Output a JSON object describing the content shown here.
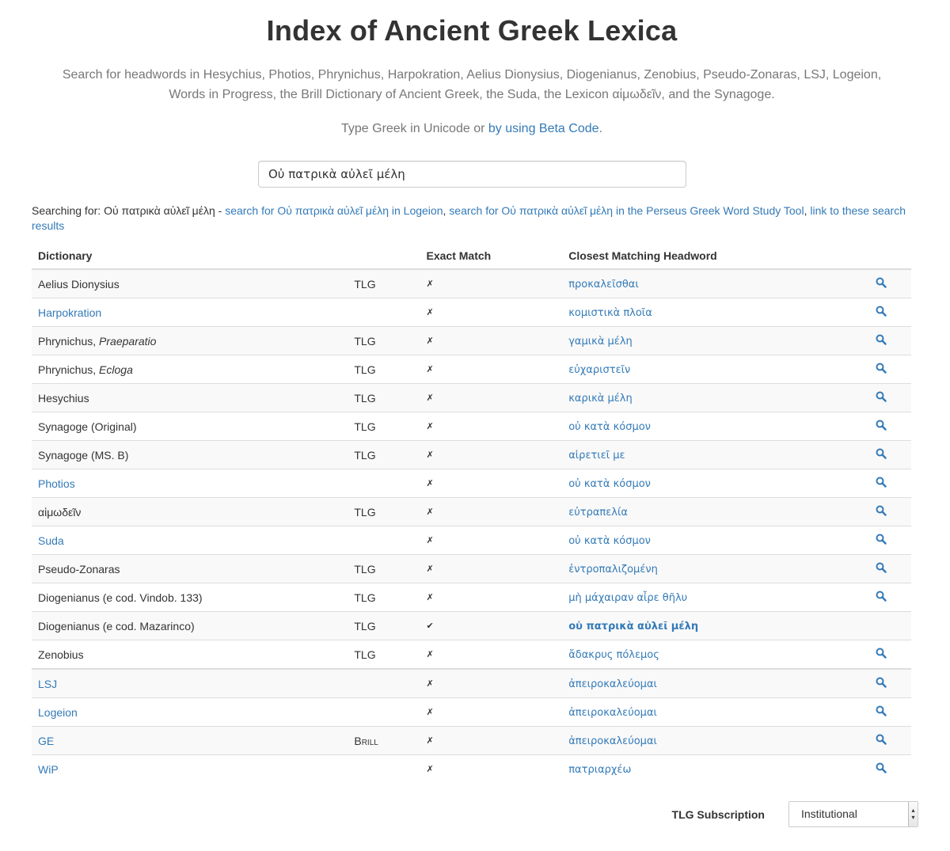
{
  "page": {
    "title": "Index of Ancient Greek Lexica",
    "description": "Search for headwords in Hesychius, Photios, Phrynichus, Harpokration, Aelius Dionysius, Diogenianus, Zenobius, Pseudo-Zonaras, LSJ, Logeion, Words in Progress, the Brill Dictionary of Ancient Greek, the Suda, the Lexicon αἱμωδεῖν, and the Synagoge.",
    "hint_prefix": "Type Greek in Unicode or ",
    "hint_link": "by using Beta Code",
    "hint_suffix": "."
  },
  "search": {
    "value": "Οὐ πατρικὰ αὐλεῖ μέλη",
    "placeholder": ""
  },
  "searching": {
    "prefix": "Searching for: ",
    "term": "Οὐ πατρικὰ αὐλεῖ μέλη",
    "separator": " - ",
    "logeion_link": "search for Οὐ πατρικὰ αὐλεῖ μέλη in Logeion",
    "comma1": ", ",
    "perseus_link": "search for Οὐ πατρικὰ αὐλεῖ μέλη in the Perseus Greek Word Study Tool",
    "comma2": ", ",
    "permalink": "link to these search results"
  },
  "table": {
    "headers": [
      "Dictionary",
      "",
      "Exact Match",
      "Closest Matching Headword",
      ""
    ],
    "rows": [
      {
        "name": "Aelius Dionysius",
        "italic": "",
        "link": false,
        "tlg": "TLG",
        "match": "✗",
        "headword": "προκαλεῖσθαι",
        "exact": false,
        "icon": true
      },
      {
        "name": "Harpokration",
        "italic": "",
        "link": true,
        "tlg": "",
        "match": "✗",
        "headword": "κομιστικὰ πλοῖα",
        "exact": false,
        "icon": true
      },
      {
        "name": "Phrynichus, ",
        "italic": "Praeparatio",
        "link": false,
        "tlg": "TLG",
        "match": "✗",
        "headword": "γαμικὰ μέλη",
        "exact": false,
        "icon": true
      },
      {
        "name": "Phrynichus, ",
        "italic": "Ecloga",
        "link": false,
        "tlg": "TLG",
        "match": "✗",
        "headword": "εὐχαριστεῖν",
        "exact": false,
        "icon": true
      },
      {
        "name": "Hesychius",
        "italic": "",
        "link": false,
        "tlg": "TLG",
        "match": "✗",
        "headword": "καρικὰ μέλη",
        "exact": false,
        "icon": true
      },
      {
        "name": "Synagoge (Original)",
        "italic": "",
        "link": false,
        "tlg": "TLG",
        "match": "✗",
        "headword": "οὐ κατὰ κόσμον",
        "exact": false,
        "icon": true
      },
      {
        "name": "Synagoge (MS. B)",
        "italic": "",
        "link": false,
        "tlg": "TLG",
        "match": "✗",
        "headword": "αἱρετιεῖ με",
        "exact": false,
        "icon": true
      },
      {
        "name": "Photios",
        "italic": "",
        "link": true,
        "tlg": "",
        "match": "✗",
        "headword": "οὐ κατὰ κόσμον",
        "exact": false,
        "icon": true
      },
      {
        "name": "αἱμωδεῖν",
        "italic": "",
        "link": false,
        "tlg": "TLG",
        "match": "✗",
        "headword": "εὐτραπελία",
        "exact": false,
        "icon": true
      },
      {
        "name": "Suda",
        "italic": "",
        "link": true,
        "tlg": "",
        "match": "✗",
        "headword": "οὐ κατὰ κόσμον",
        "exact": false,
        "icon": true
      },
      {
        "name": "Pseudo-Zonaras",
        "italic": "",
        "link": false,
        "tlg": "TLG",
        "match": "✗",
        "headword": "ἐντροπαλιζομένη",
        "exact": false,
        "icon": true
      },
      {
        "name": "Diogenianus (e cod. Vindob. 133)",
        "italic": "",
        "link": false,
        "tlg": "TLG",
        "match": "✗",
        "headword": "μὴ μάχαιραν αἶρε θῆλυ",
        "exact": false,
        "icon": true
      },
      {
        "name": "Diogenianus (e cod. Mazarinco)",
        "italic": "",
        "link": false,
        "tlg": "TLG",
        "match": "✔",
        "headword": "οὐ πατρικὰ αὐλεῖ μέλη",
        "exact": true,
        "icon": false
      },
      {
        "name": "Zenobius",
        "italic": "",
        "link": false,
        "tlg": "TLG",
        "match": "✗",
        "headword": "ἄδακρυς πόλεμος",
        "exact": false,
        "icon": true
      },
      {
        "name": "LSJ",
        "italic": "",
        "link": true,
        "tlg": "",
        "match": "✗",
        "headword": "ἀπειροκαλεύομαι",
        "exact": false,
        "icon": true,
        "sep": true
      },
      {
        "name": "Logeion",
        "italic": "",
        "link": true,
        "tlg": "",
        "match": "✗",
        "headword": "ἀπειροκαλεύομαι",
        "exact": false,
        "icon": true
      },
      {
        "name": "GE",
        "italic": "",
        "link": true,
        "tlg": "Brill",
        "match": "✗",
        "headword": "ἀπειροκαλεύομαι",
        "exact": false,
        "icon": true
      },
      {
        "name": "WiP",
        "italic": "",
        "link": true,
        "tlg": "",
        "match": "✗",
        "headword": "πατριαρχέω",
        "exact": false,
        "icon": true
      }
    ]
  },
  "footer": {
    "label": "TLG Subscription",
    "selected": "Institutional"
  },
  "icons": {
    "row_icon": "magnifier-icon",
    "select_arrow": "select-arrows-icon"
  },
  "colors": {
    "link": "#337ab7",
    "muted": "#777777",
    "tlg_label": "#cccccc"
  }
}
